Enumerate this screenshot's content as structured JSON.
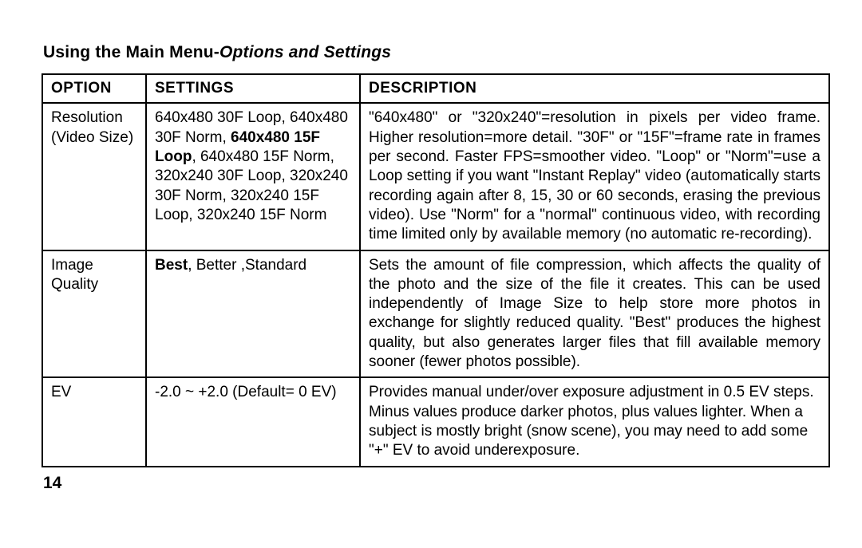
{
  "heading": {
    "prefix": "Using the Main Menu-",
    "emph": "Options and Settings"
  },
  "columns": {
    "option": "OPTION",
    "settings": "SETTINGS",
    "description": "DESCRIPTION"
  },
  "rows": {
    "r1": {
      "option_l1": "Resolution",
      "option_l2": "(Video Size)",
      "set_p1": "640x480 30F Loop, 640x480 30F Norm, ",
      "set_b": "640x480 15F Loop",
      "set_p2": ", 640x480 15F Norm, 320x240 30F Loop, 320x240 30F Norm, 320x240 15F Loop, 320x240 15F Norm",
      "desc": "\"640x480\" or \"320x240\"=resolution in pixels per video frame. Higher resolution=more detail. \"30F\" or \"15F\"=frame rate in frames per second. Faster FPS=smoother video. \"Loop\" or \"Norm\"=use a Loop setting if you want \"Instant Replay\" video (automatically starts recording again after 8, 15, 30 or 60 seconds, erasing the previous video).  Use \"Norm\" for a \"normal\" continuous video, with recording time limited only by available memory (no automatic re-recording)."
    },
    "r2": {
      "option_l1": "Image",
      "option_l2": "Quality",
      "set_b": "Best",
      "set_p": ", Better ,Standard",
      "desc": "Sets the amount of file compression, which affects the quality of the photo and the size of the file it creates. This can be used independently of Image Size to help store more photos in exchange for slightly reduced quality. \"Best\" produces the highest quality, but also generates larger files that fill available memory sooner (fewer photos possible)."
    },
    "r3": {
      "option": "EV",
      "settings": "-2.0 ~ +2.0 (Default= 0 EV)",
      "desc": "Provides manual under/over exposure adjustment in 0.5 EV steps. Minus values produce darker photos, plus values lighter. When a subject is mostly bright (snow scene), you may need to add some \"+\" EV to avoid underexposure."
    }
  },
  "page_number": "14"
}
